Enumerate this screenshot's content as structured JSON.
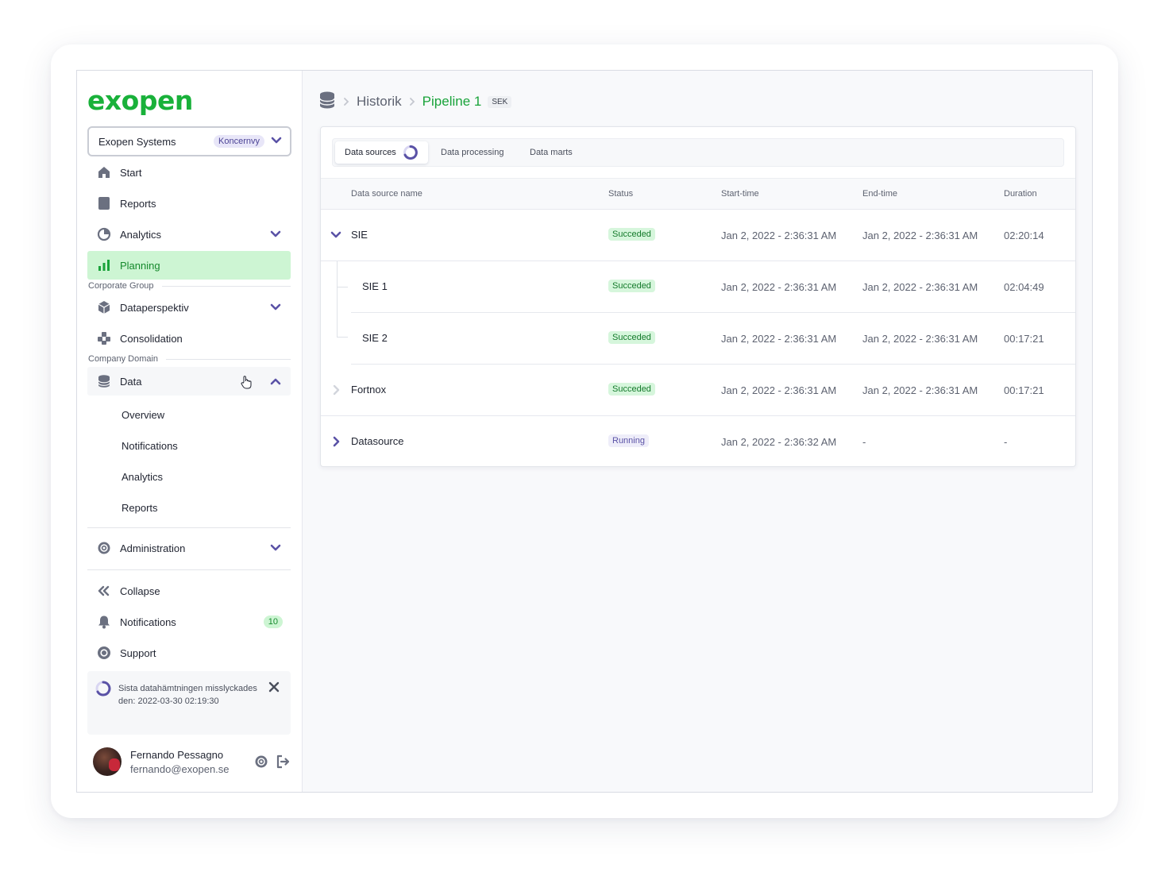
{
  "brand": {
    "logo_text": "exopen",
    "color": "#19b13a"
  },
  "org_selector": {
    "name": "Exopen Systems",
    "badge": "Koncernvy"
  },
  "sidebar": {
    "items": [
      {
        "label": "Start",
        "icon": "home-icon"
      },
      {
        "label": "Reports",
        "icon": "report-icon"
      },
      {
        "label": "Analytics",
        "icon": "pie-chart-icon"
      },
      {
        "label": "Planning",
        "icon": "bar-chart-icon"
      },
      {
        "label": "Dataperspektiv",
        "icon": "cube-icon"
      },
      {
        "label": "Consolidation",
        "icon": "puzzle-icon"
      },
      {
        "label": "Data",
        "icon": "database-icon"
      },
      {
        "label": "Administration",
        "icon": "gear-icon"
      }
    ],
    "section_corporate": "Corporate Group",
    "section_company": "Company Domain",
    "data_subitems": [
      "Overview",
      "Notifications",
      "Analytics",
      "Reports"
    ],
    "bottom": {
      "collapse": "Collapse",
      "notifications": "Notifications",
      "notifications_count": "10",
      "support": "Support"
    },
    "alert": {
      "text": "Sista datahämtningen misslyckades den: 2022-03-30 02:19:30"
    },
    "user": {
      "name": "Fernando Pessagno",
      "email": "fernando@exopen.se"
    }
  },
  "breadcrumb": {
    "items": [
      "Historik",
      "Pipeline 1"
    ],
    "currency": "SEK"
  },
  "tabs": [
    "Data sources",
    "Data processing",
    "Data marts"
  ],
  "table": {
    "columns": [
      "Data source name",
      "Status",
      "Start-time",
      "End-time",
      "Duration"
    ],
    "rows": [
      {
        "name": "SIE",
        "status": "Succeded",
        "start": "Jan 2, 2022 - 2:36:31 AM",
        "end": "Jan 2, 2022 - 2:36:31 AM",
        "duration": "02:20:14"
      },
      {
        "name": "SIE 1",
        "status": "Succeded",
        "start": "Jan 2, 2022 - 2:36:31 AM",
        "end": "Jan 2, 2022 - 2:36:31 AM",
        "duration": "02:04:49"
      },
      {
        "name": "SIE 2",
        "status": "Succeded",
        "start": "Jan 2, 2022 - 2:36:31 AM",
        "end": "Jan 2, 2022 - 2:36:31 AM",
        "duration": "00:17:21"
      },
      {
        "name": "Fortnox",
        "status": "Succeded",
        "start": "Jan 2, 2022 - 2:36:31 AM",
        "end": "Jan 2, 2022 - 2:36:31 AM",
        "duration": "00:17:21"
      },
      {
        "name": "Datasource",
        "status": "Running",
        "start": "Jan 2, 2022 - 2:36:32 AM",
        "end": "-",
        "duration": "-"
      }
    ]
  },
  "colors": {
    "accent": "#5a52a6",
    "success": "#19a33a",
    "active_bg": "#cdf5d3"
  }
}
